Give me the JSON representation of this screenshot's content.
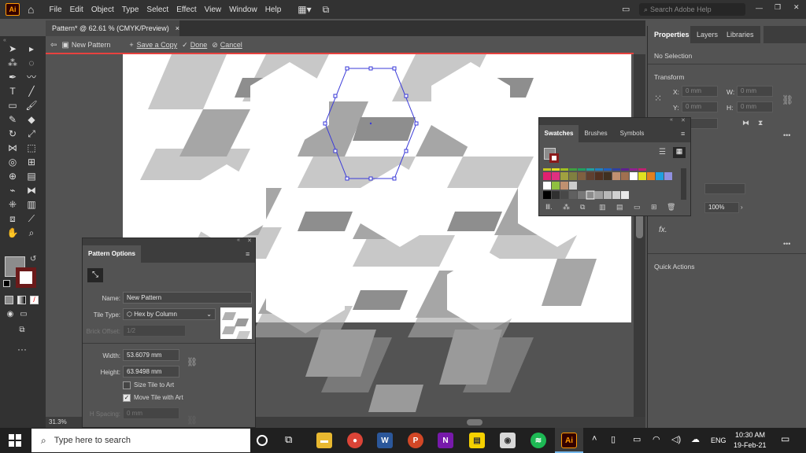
{
  "app": {
    "logo": "Ai"
  },
  "menus": [
    "File",
    "Edit",
    "Object",
    "Type",
    "Select",
    "Effect",
    "View",
    "Window",
    "Help"
  ],
  "search": {
    "placeholder": "Search Adobe Help"
  },
  "document_tab": {
    "title": "Pattern* @ 62.61 % (CMYK/Preview)",
    "close": "×"
  },
  "edit_bar": {
    "pattern_name": "New Pattern",
    "save_copy": "Save a Copy",
    "done": "Done",
    "cancel": "Cancel"
  },
  "properties": {
    "tabs": [
      "Properties",
      "Layers",
      "Libraries"
    ],
    "selection": "No Selection",
    "transform_title": "Transform",
    "x_label": "X:",
    "x_value": "0 mm",
    "y_label": "Y:",
    "y_value": "0 mm",
    "w_label": "W:",
    "w_value": "0 mm",
    "h_label": "H:",
    "h_value": "0 mm",
    "opacity": "100%",
    "fx": "fx.",
    "quick_actions": "Quick Actions"
  },
  "swatches_panel": {
    "tabs": [
      "Swatches",
      "Brushes",
      "Symbols"
    ]
  },
  "pattern_options": {
    "title": "Pattern Options",
    "name_label": "Name:",
    "name_value": "New Pattern",
    "tile_type_label": "Tile Type:",
    "tile_type_value": "Hex by Column",
    "brick_offset_label": "Brick Offset:",
    "brick_offset_value": "1/2",
    "width_label": "Width:",
    "width_value": "53.6079 mm",
    "height_label": "Height:",
    "height_value": "63.9498 mm",
    "size_tile": "Size Tile to Art",
    "move_tile": "Move Tile with Art",
    "hspacing_label": "H Spacing:",
    "hspacing_value": "0 mm"
  },
  "status": {
    "zoom": "31.3%"
  },
  "taskbar": {
    "search_placeholder": "Type here to search",
    "lang": "ENG",
    "time": "10:30 AM",
    "date": "19-Feb-21"
  },
  "colors": {
    "accent_red": "#e8423f",
    "ai_orange": "#ff9a00",
    "ai_bg": "#330000"
  }
}
